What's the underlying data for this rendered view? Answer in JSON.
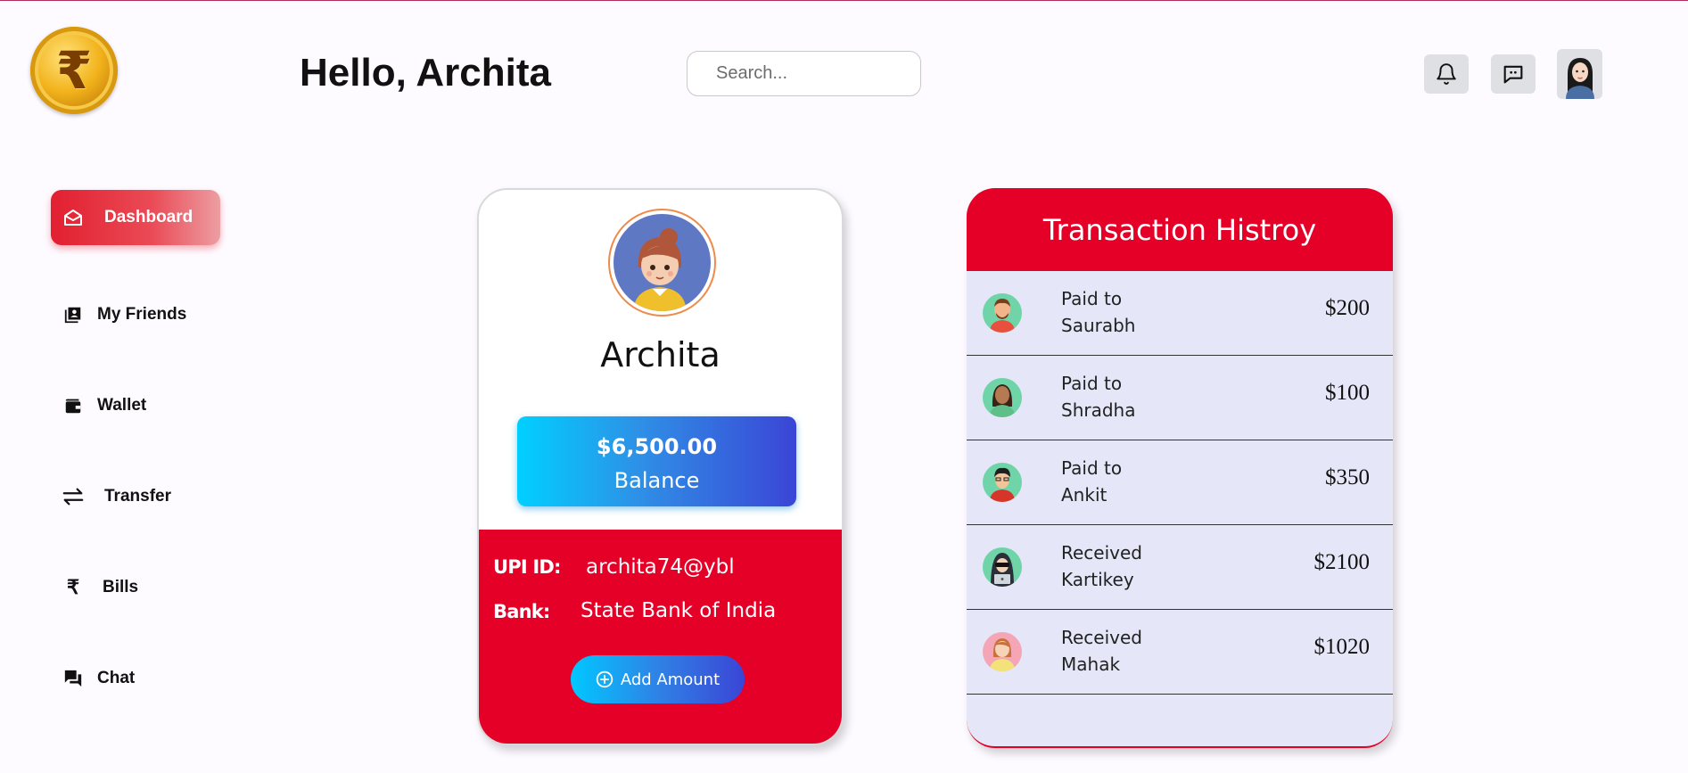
{
  "header": {
    "logo_symbol": "₹",
    "greeting": "Hello, Archita",
    "search_placeholder": "Search..."
  },
  "sidebar": {
    "items": [
      {
        "label": "Dashboard",
        "icon": "envelope-open-icon",
        "active": true
      },
      {
        "label": "My Friends",
        "icon": "contacts-icon",
        "active": false
      },
      {
        "label": "Wallet",
        "icon": "wallet-icon",
        "active": false
      },
      {
        "label": "Transfer",
        "icon": "transfer-arrows-icon",
        "active": false
      },
      {
        "label": "Bills",
        "icon": "rupee-icon",
        "active": false
      },
      {
        "label": "Chat",
        "icon": "chat-icon",
        "active": false
      }
    ]
  },
  "profile": {
    "name": "Archita",
    "balance_amount": "$6,500.00",
    "balance_label": "Balance",
    "upi_label": "UPI ID:",
    "upi_value": "archita74@ybl",
    "bank_label": "Bank:",
    "bank_value": "State Bank of India",
    "add_button_label": "Add Amount"
  },
  "transactions": {
    "title": "Transaction Histroy",
    "rows": [
      {
        "action": "Paid to",
        "person": "Saurabh",
        "amount": "$200"
      },
      {
        "action": "Paid to",
        "person": "Shradha",
        "amount": "$100"
      },
      {
        "action": "Paid to",
        "person": "Ankit",
        "amount": "$350"
      },
      {
        "action": "Received",
        "person": "Kartikey",
        "amount": "$2100"
      },
      {
        "action": "Received",
        "person": "Mahak",
        "amount": "$1020"
      }
    ]
  },
  "colors": {
    "accent_red": "#e50027",
    "balance_gradient_start": "#00d0ff",
    "balance_gradient_end": "#3b45d6",
    "tx_background": "#e5e7f8"
  }
}
